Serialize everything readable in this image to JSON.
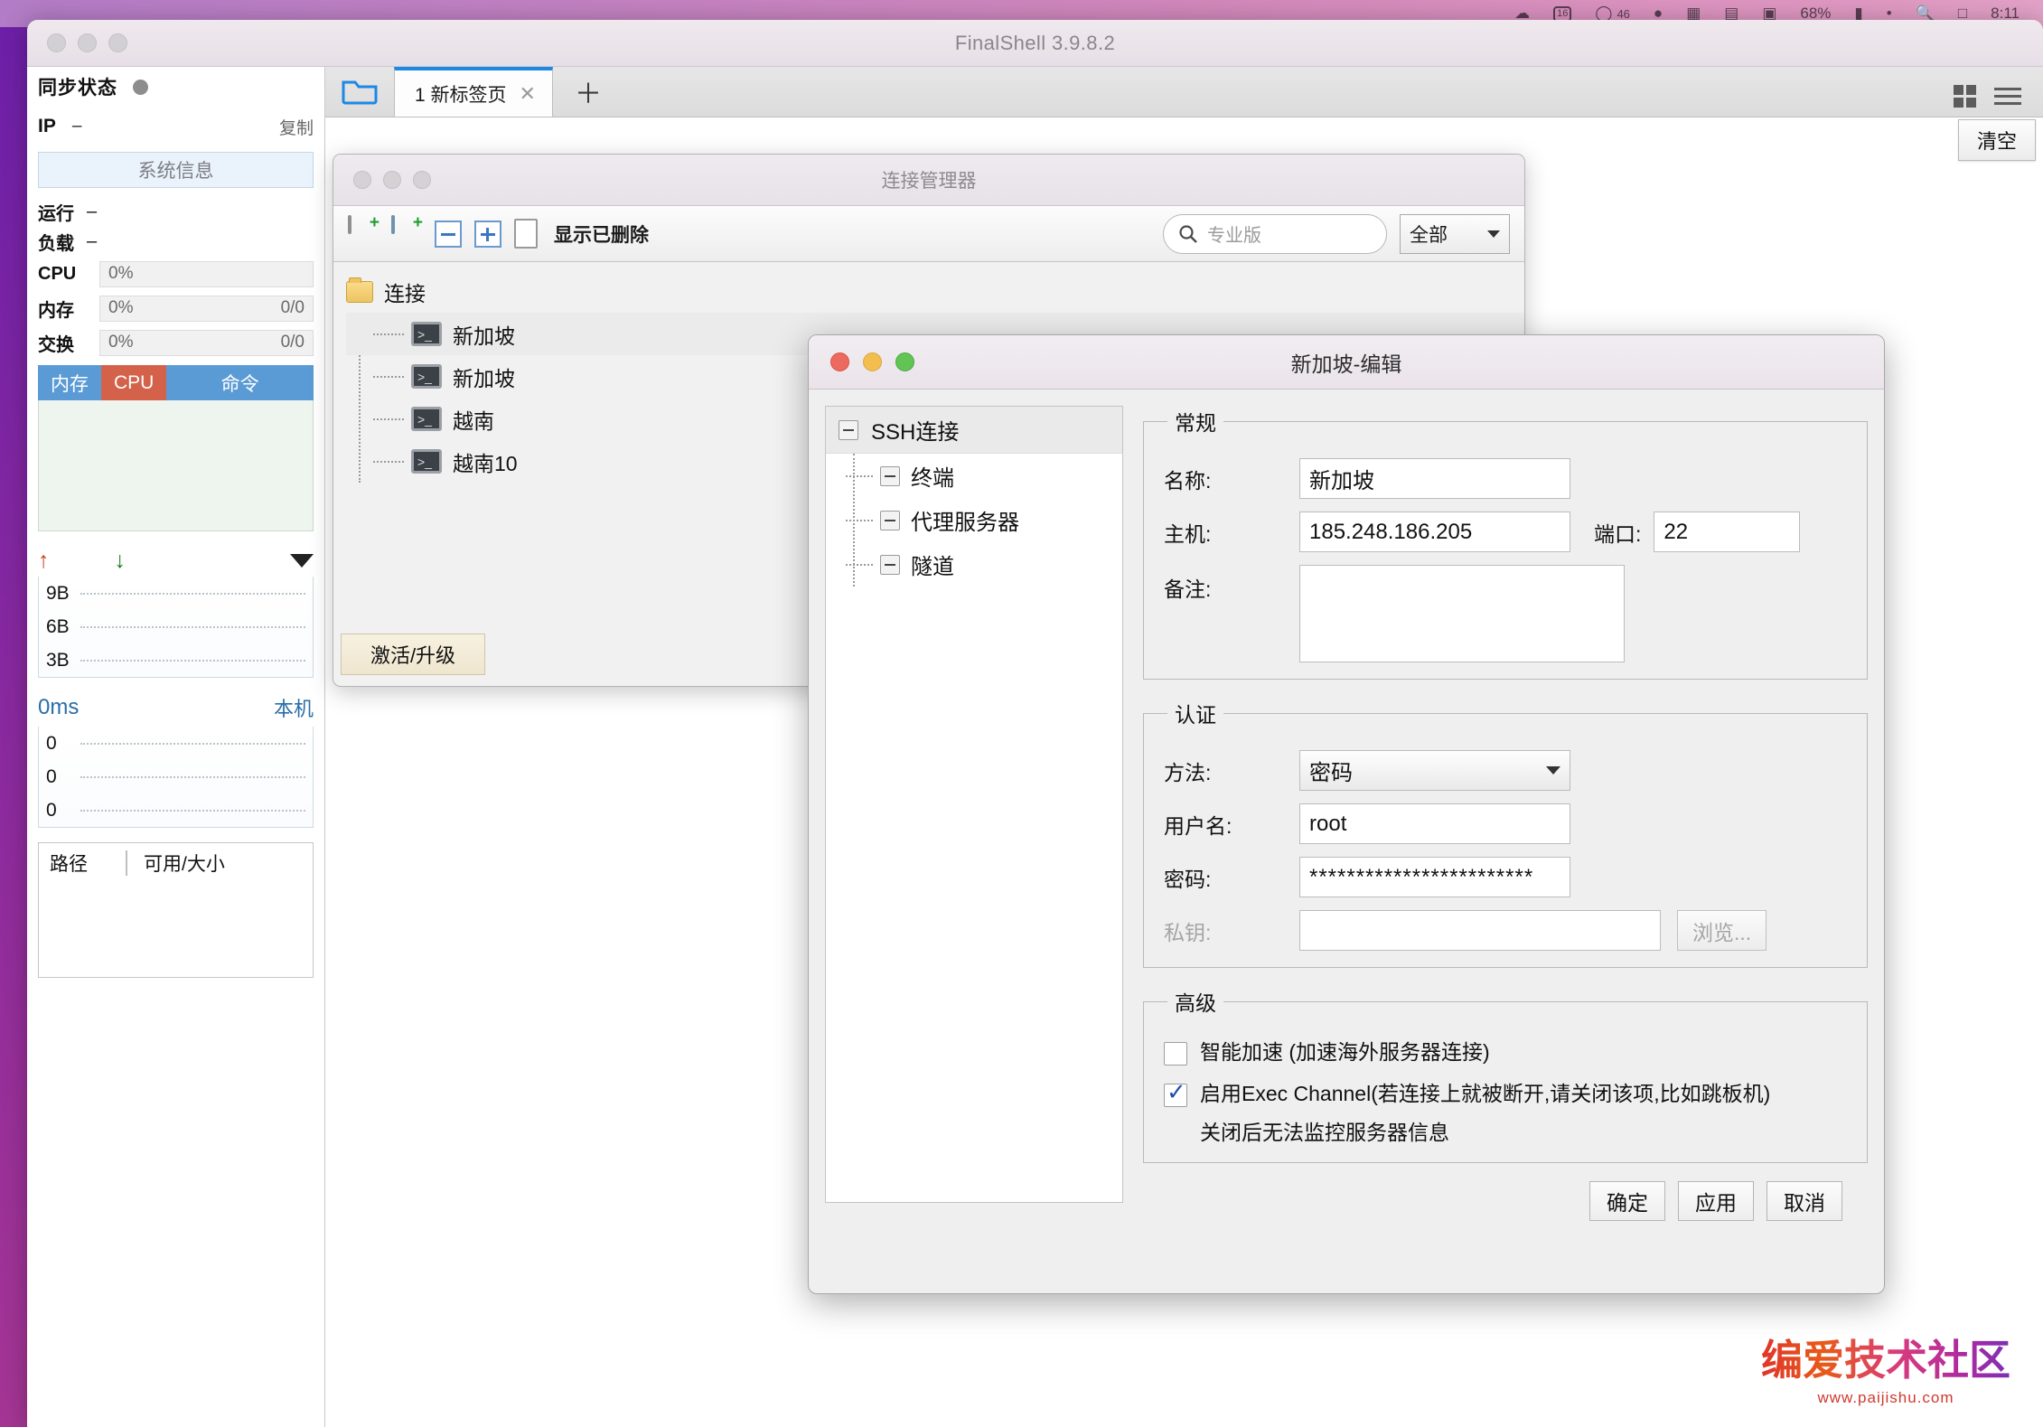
{
  "menubar": {
    "items": [
      "☁",
      "16",
      "46",
      "●",
      "■",
      "▤",
      "▦",
      "68%",
      "▮",
      "•",
      "🔍",
      "□",
      "8:11"
    ]
  },
  "app": {
    "title": "FinalShell 3.9.8.2"
  },
  "sidebar": {
    "sync_label": "同步状态",
    "ip_label": "IP",
    "ip_value": "–",
    "copy_label": "复制",
    "sysinfo_button": "系统信息",
    "uptime_label": "运行",
    "uptime_value": "–",
    "load_label": "负载",
    "load_value": "–",
    "meters": [
      {
        "label": "CPU",
        "percent": "0%",
        "detail": ""
      },
      {
        "label": "内存",
        "percent": "0%",
        "detail": "0/0"
      },
      {
        "label": "交换",
        "percent": "0%",
        "detail": "0/0"
      }
    ],
    "tabs": [
      {
        "label": "内存",
        "color": "#5b9bd5"
      },
      {
        "label": "CPU",
        "color": "#d4624a"
      },
      {
        "label": "命令",
        "color": "#5b9bd5"
      }
    ],
    "net_axis": [
      "9B",
      "6B",
      "3B"
    ],
    "ping_value": "0ms",
    "ping_host": "本机",
    "ping_axis": [
      "0",
      "0",
      "0"
    ],
    "disk_headers": [
      "路径",
      "可用/大小"
    ]
  },
  "tabbar": {
    "tab_label": "1 新标签页",
    "close_glyph": "✕",
    "plus_glyph": "＋"
  },
  "connection_manager": {
    "title": "连接管理器",
    "toolbar_checkbox_label": "显示已删除",
    "search_placeholder": "专业版",
    "filter_value": "全部",
    "tree_root": "连接",
    "tree_items": [
      "新加坡",
      "新加坡",
      "越南",
      "越南10"
    ],
    "activate_button": "激活/升级",
    "clear_button": "清空"
  },
  "edit_dialog": {
    "title": "新加坡-编辑",
    "nav": {
      "root": "SSH连接",
      "items": [
        "终端",
        "代理服务器",
        "隧道"
      ]
    },
    "general": {
      "legend": "常规",
      "name_label": "名称:",
      "name_value": "新加坡",
      "host_label": "主机:",
      "host_value": "185.248.186.205",
      "port_label": "端口:",
      "port_value": "22",
      "note_label": "备注:",
      "note_value": ""
    },
    "auth": {
      "legend": "认证",
      "method_label": "方法:",
      "method_value": "密码",
      "username_label": "用户名:",
      "username_value": "root",
      "password_label": "密码:",
      "password_value": "************************",
      "privatekey_label": "私钥:",
      "privatekey_value": "",
      "browse_button": "浏览..."
    },
    "advanced": {
      "legend": "高级",
      "smart_accel_label": "智能加速 (加速海外服务器连接)",
      "smart_accel_checked": false,
      "exec_channel_label": "启用Exec Channel(若连接上就被断开,请关闭该项,比如跳板机)",
      "exec_channel_checked": true,
      "exec_channel_sub": "关闭后无法监控服务器信息"
    },
    "buttons": {
      "ok": "确定",
      "apply": "应用",
      "cancel": "取消"
    }
  },
  "watermark": {
    "main": "编爱技术社区",
    "sub": "www.paijishu.com"
  },
  "colors": {
    "accent_blue": "#1e88e5",
    "mem_tab": "#5b9bd5",
    "cpu_tab": "#d4624a",
    "up_arrow": "#c8451f",
    "down_arrow": "#16801d",
    "ping_text": "#2a6ea8"
  }
}
